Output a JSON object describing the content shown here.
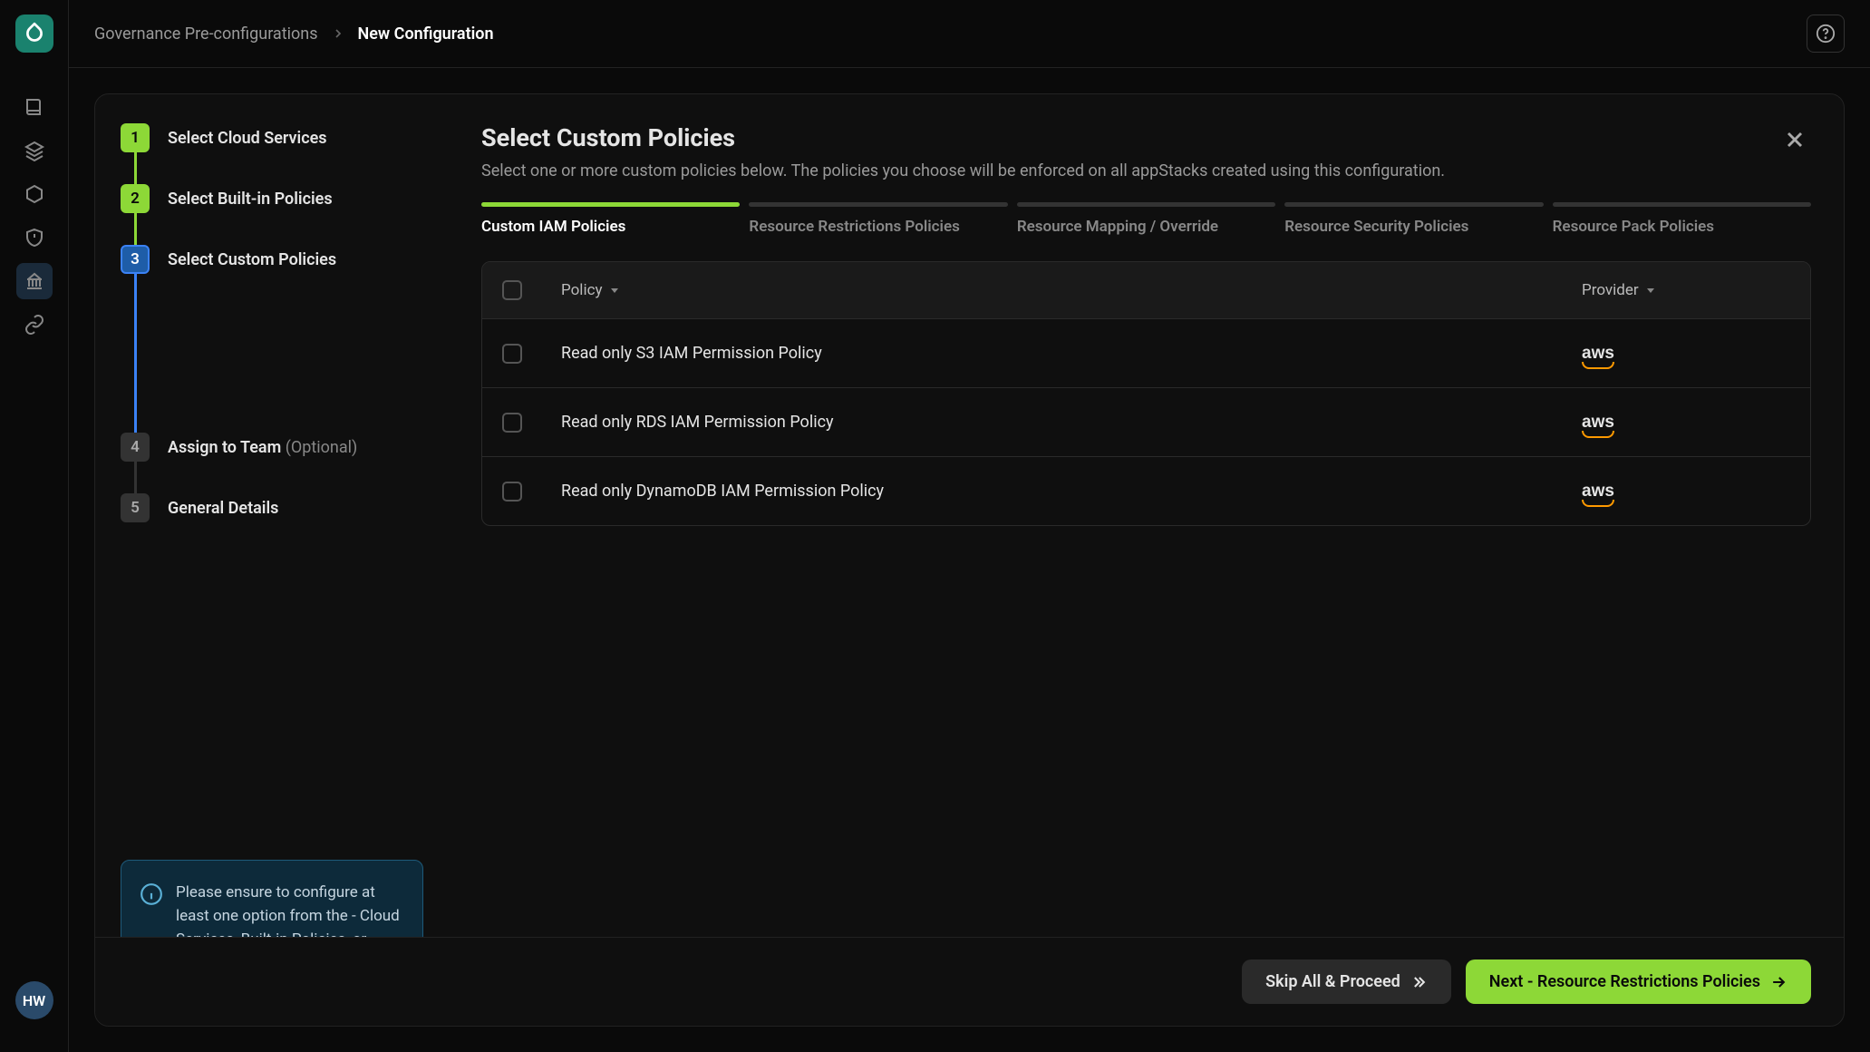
{
  "breadcrumb": {
    "item1": "Governance Pre-configurations",
    "item2": "New Configuration"
  },
  "avatar": "HW",
  "steps": [
    {
      "num": "1",
      "label": "Select Cloud Services",
      "state": "done"
    },
    {
      "num": "2",
      "label": "Select Built-in Policies",
      "state": "done"
    },
    {
      "num": "3",
      "label": "Select Custom Policies",
      "state": "active"
    },
    {
      "num": "4",
      "label": "Assign to Team",
      "optional": "(Optional)",
      "state": "pending"
    },
    {
      "num": "5",
      "label": "General Details",
      "state": "pending"
    }
  ],
  "info": "Please ensure to configure at least one option from the - Cloud Services, Built-in Policies, or Custom Policies.",
  "detail": {
    "title": "Select Custom Policies",
    "subtitle": "Select one or more custom policies below. The policies you choose will be enforced on all appStacks created using this configuration."
  },
  "subtabs": [
    "Custom IAM Policies",
    "Resource Restrictions Policies",
    "Resource Mapping / Override",
    "Resource Security Policies",
    "Resource Pack Policies"
  ],
  "table": {
    "headers": {
      "policy": "Policy",
      "provider": "Provider"
    },
    "rows": [
      {
        "policy": "Read only S3 IAM Permission Policy",
        "provider": "aws"
      },
      {
        "policy": "Read only RDS IAM Permission Policy",
        "provider": "aws"
      },
      {
        "policy": "Read only DynamoDB IAM Permission Policy",
        "provider": "aws"
      }
    ]
  },
  "footer": {
    "skip": "Skip All & Proceed",
    "next": "Next - Resource Restrictions Policies"
  }
}
